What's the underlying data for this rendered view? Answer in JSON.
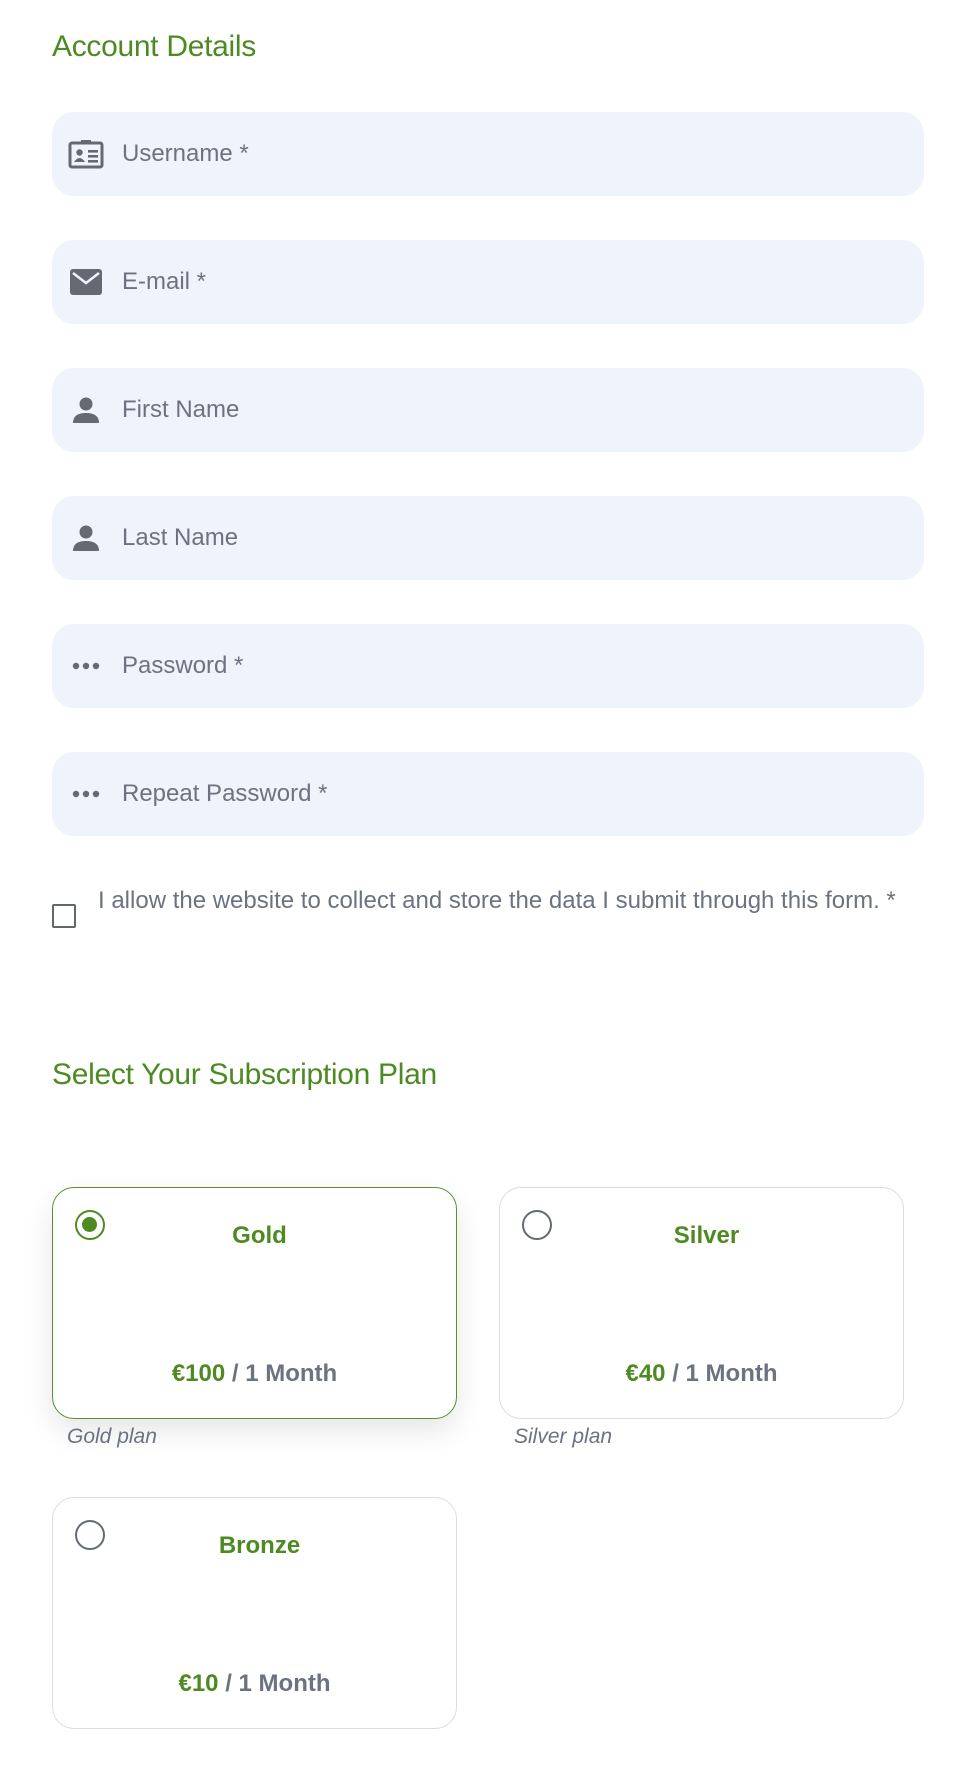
{
  "account": {
    "title": "Account Details",
    "fields": {
      "username": {
        "placeholder": "Username *",
        "icon": "id-card-icon"
      },
      "email": {
        "placeholder": "E-mail *",
        "icon": "envelope-icon"
      },
      "first_name": {
        "placeholder": "First Name",
        "icon": "user-icon"
      },
      "last_name": {
        "placeholder": "Last Name",
        "icon": "user-icon"
      },
      "password": {
        "placeholder": "Password *",
        "icon": "dots-icon"
      },
      "repeat_password": {
        "placeholder": "Repeat Password *",
        "icon": "dots-icon"
      }
    },
    "consent": {
      "label": "I allow the website to collect and store the data I submit through this form. *",
      "checked": false
    }
  },
  "subscription": {
    "title": "Select Your Subscription Plan",
    "plans": [
      {
        "name": "Gold",
        "amount": "€100",
        "period": " / 1 Month",
        "caption": "Gold plan",
        "selected": true
      },
      {
        "name": "Silver",
        "amount": "€40",
        "period": " / 1 Month",
        "caption": "Silver plan",
        "selected": false
      },
      {
        "name": "Bronze",
        "amount": "€10",
        "period": " / 1 Month",
        "caption": "",
        "selected": false
      }
    ]
  },
  "colors": {
    "accent": "#4d8a22",
    "field_bg": "#eff3fb",
    "text_muted": "#6b7280"
  }
}
